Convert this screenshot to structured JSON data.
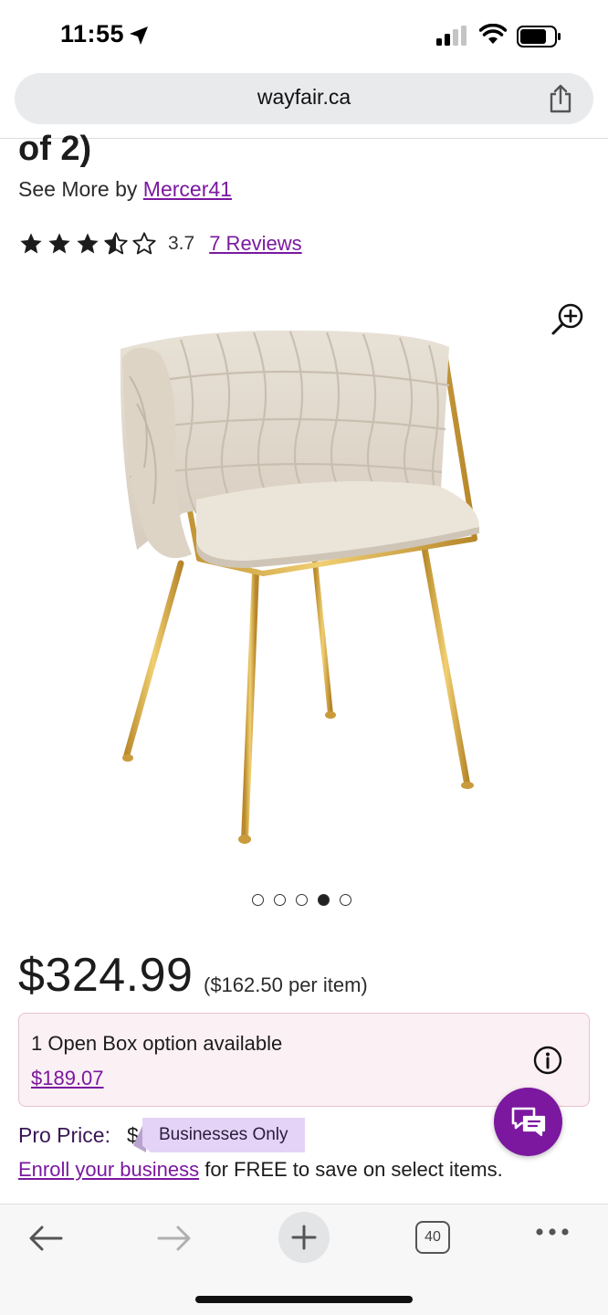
{
  "status_bar": {
    "time": "11:55"
  },
  "browser": {
    "url": "wayfair.ca",
    "tab_count": "40"
  },
  "product": {
    "title_tail": "of 2)",
    "see_more_prefix": "See More by",
    "brand": "Mercer41",
    "rating": {
      "stars": 3.5,
      "value": "3.7",
      "reviews": "7 Reviews"
    },
    "carousel": {
      "count": 5,
      "active_index": 3
    },
    "price": "$324.99",
    "per_item": "($162.50 per item)",
    "open_box": {
      "title": "1 Open Box option available",
      "price": "$189.07"
    },
    "pro_price": {
      "label": "Pro Price:",
      "dollar": "$",
      "badge": "Businesses Only",
      "enroll_link": "Enroll your business",
      "enroll_rest": " for FREE to save on select items."
    }
  },
  "colors": {
    "brand_purple": "#7b189f",
    "open_box_bg": "#fbf0f3",
    "badge_bg": "#e4d3f7"
  }
}
